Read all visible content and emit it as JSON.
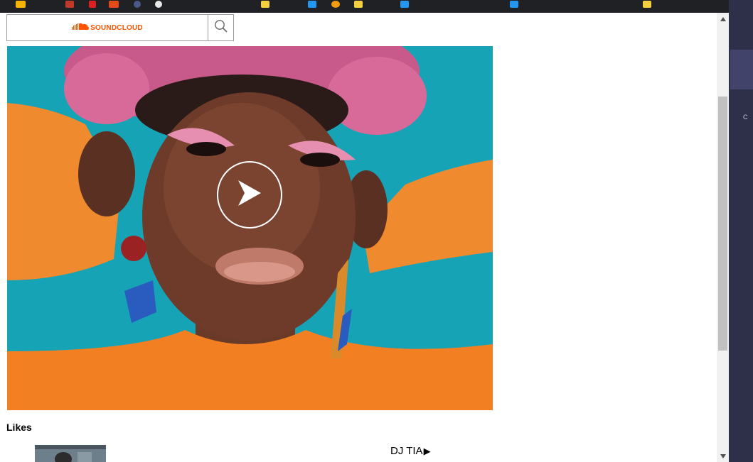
{
  "header": {
    "logo_text": "SOUNDCLOUD",
    "logo_icon": "soundcloud-cloud-icon",
    "search_icon": "search-icon",
    "brand_color": "#ff5500"
  },
  "player": {
    "artwork": "artist-portrait",
    "play_icon": "play-icon"
  },
  "likes": {
    "heading": "Likes",
    "items": [
      {
        "title": "DJ TIA",
        "play_glyph": "▶"
      }
    ]
  },
  "side_strip": {
    "labels": [
      "C"
    ]
  }
}
